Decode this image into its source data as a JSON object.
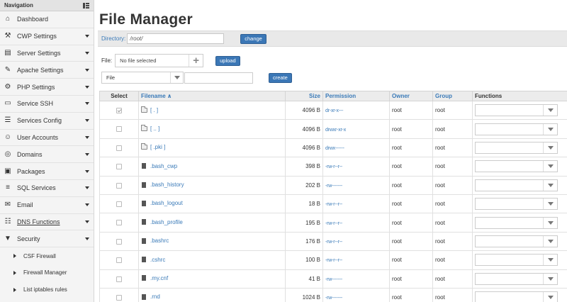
{
  "sidebar": {
    "header": "Navigation",
    "items": [
      {
        "label": "Dashboard",
        "icon": "home-icon",
        "caret": false
      },
      {
        "label": "CWP Settings",
        "icon": "wrench-icon",
        "caret": true
      },
      {
        "label": "Server Settings",
        "icon": "server-icon",
        "caret": true
      },
      {
        "label": "Apache Settings",
        "icon": "feather-icon",
        "caret": true
      },
      {
        "label": "PHP Settings",
        "icon": "gear-icon",
        "caret": true
      },
      {
        "label": "Service SSH",
        "icon": "monitor-icon",
        "caret": true
      },
      {
        "label": "Services Config",
        "icon": "list-icon",
        "caret": true
      },
      {
        "label": "User Accounts",
        "icon": "user-icon",
        "caret": true
      },
      {
        "label": "Domains",
        "icon": "globe-icon",
        "caret": true
      },
      {
        "label": "Packages",
        "icon": "boxes-icon",
        "caret": true
      },
      {
        "label": "SQL Services",
        "icon": "database-icon",
        "caret": true
      },
      {
        "label": "Email",
        "icon": "envelope-icon",
        "caret": true
      },
      {
        "label": "DNS Functions",
        "icon": "sitemap-icon",
        "caret": true
      },
      {
        "label": "Security",
        "icon": "shield-icon",
        "caret": true
      }
    ],
    "subitems": [
      "CSF Firewall",
      "Firewall Manager",
      "List iptables rules"
    ]
  },
  "page": {
    "title": "File Manager",
    "directory_label": "Directory:",
    "directory_value": "/root/",
    "change_label": "change",
    "file_label": "File:",
    "file_placeholder": "No file selected",
    "upload_label": "upload",
    "type_selected": "File",
    "create_label": "create"
  },
  "table": {
    "headers": {
      "select": "Select",
      "filename": "Filename ∧",
      "size": "Size",
      "permission": "Permission",
      "owner": "Owner",
      "group": "Group",
      "functions": "Functions"
    },
    "rows": [
      {
        "checked": true,
        "type": "folder",
        "name": "[ . ]",
        "size": "4096 B",
        "perm": "dr-xr-x---",
        "owner": "root",
        "group": "root"
      },
      {
        "checked": false,
        "type": "folder",
        "name": "[ .. ]",
        "size": "4096 B",
        "perm": "drwxr-xr-x",
        "owner": "root",
        "group": "root"
      },
      {
        "checked": false,
        "type": "folder",
        "name": "[ .pki ]",
        "size": "4096 B",
        "perm": "drwx------",
        "owner": "root",
        "group": "root"
      },
      {
        "checked": false,
        "type": "file",
        "name": ".bash_cwp",
        "size": "398 B",
        "perm": "-rw-r--r--",
        "owner": "root",
        "group": "root"
      },
      {
        "checked": false,
        "type": "file",
        "name": ".bash_history",
        "size": "202 B",
        "perm": "-rw-------",
        "owner": "root",
        "group": "root"
      },
      {
        "checked": false,
        "type": "file",
        "name": ".bash_logout",
        "size": "18 B",
        "perm": "-rw-r--r--",
        "owner": "root",
        "group": "root"
      },
      {
        "checked": false,
        "type": "file",
        "name": ".bash_profile",
        "size": "195 B",
        "perm": "-rw-r--r--",
        "owner": "root",
        "group": "root"
      },
      {
        "checked": false,
        "type": "file",
        "name": ".bashrc",
        "size": "176 B",
        "perm": "-rw-r--r--",
        "owner": "root",
        "group": "root"
      },
      {
        "checked": false,
        "type": "file",
        "name": ".cshrc",
        "size": "100 B",
        "perm": "-rw-r--r--",
        "owner": "root",
        "group": "root"
      },
      {
        "checked": false,
        "type": "file",
        "name": ".my.cnf",
        "size": "41 B",
        "perm": "-rw-------",
        "owner": "root",
        "group": "root"
      },
      {
        "checked": false,
        "type": "file",
        "name": ".rnd",
        "size": "1024 B",
        "perm": "-rw-------",
        "owner": "root",
        "group": "root"
      }
    ]
  }
}
